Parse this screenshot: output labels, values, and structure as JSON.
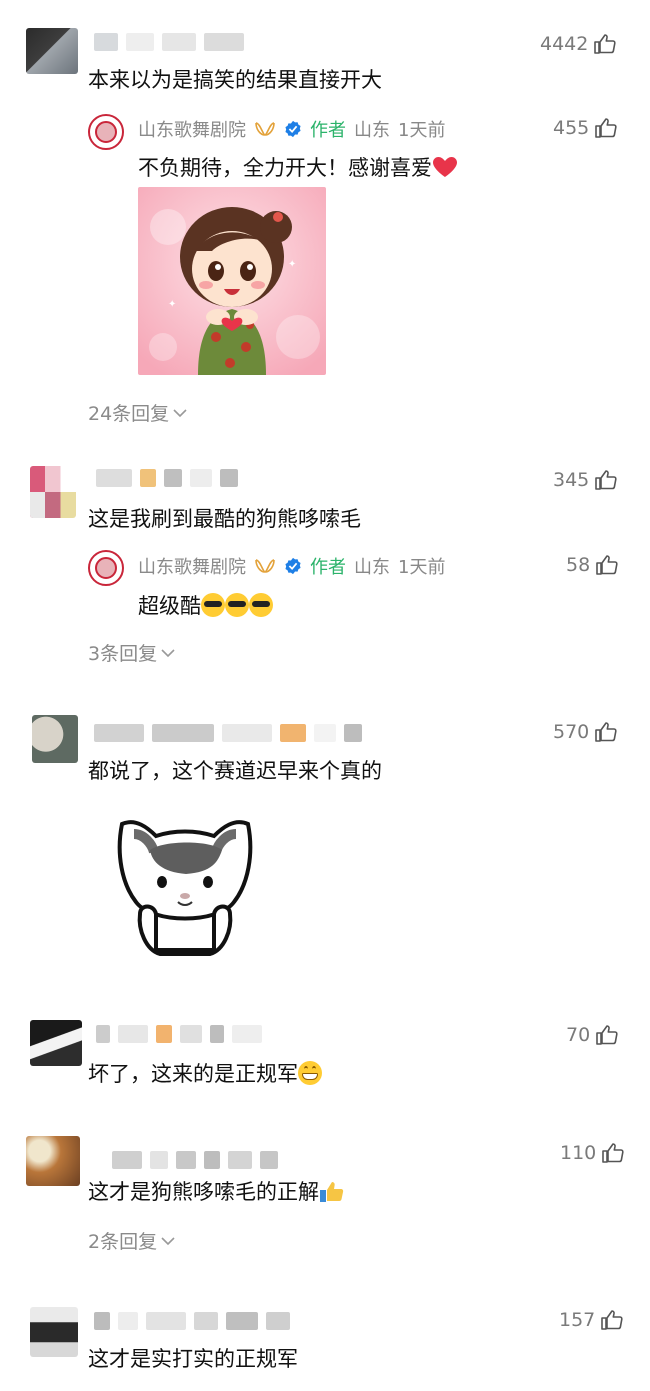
{
  "comments": [
    {
      "text": "本来以为是搞笑的结果直接开大",
      "likes": "4442",
      "reply": {
        "author": "山东歌舞剧院",
        "tag": "作者",
        "location": "山东",
        "time": "1天前",
        "likes": "455",
        "text": "不负期待，全力开大！感谢喜爱"
      },
      "more_replies": "24条回复"
    },
    {
      "text": "这是我刷到最酷的狗熊哆嗦毛",
      "likes": "345",
      "reply": {
        "author": "山东歌舞剧院",
        "tag": "作者",
        "location": "山东",
        "time": "1天前",
        "likes": "58",
        "text": "超级酷"
      },
      "more_replies": "3条回复"
    },
    {
      "text": "都说了，这个赛道迟早来个真的",
      "likes": "570"
    },
    {
      "text": "坏了，这来的是正规军",
      "likes": "70"
    },
    {
      "text": "这才是狗熊哆嗦毛的正解",
      "likes": "110",
      "more_replies": "2条回复"
    },
    {
      "text": "这才是实打实的正规军",
      "likes": "157"
    }
  ],
  "icons": {
    "like": "thumbs-up-icon",
    "expand": "chevron-down-icon",
    "verified": "verified-badge-icon",
    "member": "member-ribbon-icon",
    "heart": "red-heart-emoji",
    "cool": "sunglasses-emoji",
    "grin": "grinning-emoji",
    "thumb_emoji": "thumbs-up-emoji"
  },
  "colors": {
    "author_tag": "#2bb36a",
    "verified": "#1e7fe6",
    "meta": "#888888"
  }
}
